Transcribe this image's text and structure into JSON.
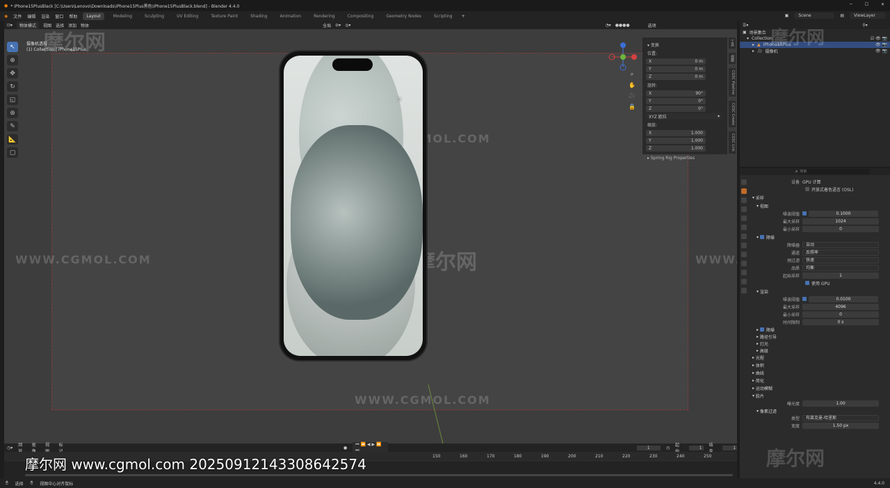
{
  "window": {
    "title": "* iPhone15PlusBlack [C:\\Users\\Lenovo\\Downloads\\iPhone15Plus黑色\\iPhone15PlusBlack.blend] - Blender 4.4.0"
  },
  "menu": [
    "文件",
    "编辑",
    "渲染",
    "窗口",
    "帮助"
  ],
  "workspaces": [
    "Layout",
    "Modeling",
    "Sculpting",
    "UV Editing",
    "Texture Paint",
    "Shading",
    "Animation",
    "Rendering",
    "Compositing",
    "Geometry Nodes",
    "Scripting"
  ],
  "active_workspace": "Layout",
  "top_right": {
    "scene": "Scene",
    "view_layer": "ViewLayer"
  },
  "viewport_header": {
    "mode": "物体模式",
    "items": [
      "视图",
      "选择",
      "添加",
      "物体"
    ],
    "transform": "全局",
    "overlay_label": "选项"
  },
  "viewport_info": {
    "view": "摄像机透视",
    "collection": "(1) Collection | iPhone15Plus"
  },
  "npanel": {
    "section": "变换",
    "location_label": "位置:",
    "location": [
      {
        "axis": "X",
        "val": "0 m"
      },
      {
        "axis": "Y",
        "val": "0 m"
      },
      {
        "axis": "Z",
        "val": "0 m"
      }
    ],
    "rotation_label": "旋转:",
    "rotation": [
      {
        "axis": "X",
        "val": "90°"
      },
      {
        "axis": "Y",
        "val": "0°"
      },
      {
        "axis": "Z",
        "val": "0°"
      }
    ],
    "rotation_mode": "XYZ 欧拉",
    "scale_label": "缩放:",
    "scale": [
      {
        "axis": "X",
        "val": "1.000"
      },
      {
        "axis": "Y",
        "val": "1.000"
      },
      {
        "axis": "Z",
        "val": "1.000"
      }
    ],
    "spring": "Spring Rig Properties"
  },
  "side_tabs": [
    "工具",
    "视图",
    "CGSC Pipeline",
    "CGSC Create",
    "CGSC Link"
  ],
  "outliner": {
    "scene_collection": "场景集合",
    "items": [
      {
        "name": "Collection",
        "depth": 1,
        "selected": false
      },
      {
        "name": "iPhone15Plus",
        "depth": 2,
        "selected": true
      },
      {
        "name": "摄像机",
        "depth": 2,
        "selected": false
      }
    ]
  },
  "properties": {
    "search_placeholder": "搜索",
    "device_label": "设备",
    "device": "GPU 计算",
    "osl": "开放式着色语言 (OSL)",
    "sampling": "采样",
    "viewport": "视图",
    "vp_noise_label": "噪波阈值",
    "vp_noise": "0.1000",
    "vp_max_label": "最大采样",
    "vp_max": "1024",
    "vp_min_label": "最小采样",
    "vp_min": "0",
    "denoise": "降噪",
    "denoiser_label": "降噪器",
    "denoiser": "自动",
    "passes_label": "通道",
    "passes": "反照率",
    "prefilter_label": "预过滤",
    "prefilter": "快速",
    "quality_label": "品质",
    "quality": "均衡",
    "start_sample_label": "起始采样",
    "start_sample": "1",
    "use_gpu": "使用 GPU",
    "render": "渲染",
    "r_noise_label": "噪波阈值",
    "r_noise": "0.0100",
    "r_max_label": "最大采样",
    "r_max": "4096",
    "r_min_label": "最小采样",
    "r_min": "0",
    "r_time_label": "时间限制",
    "r_time": "0 s",
    "sub_sections": [
      "降噪",
      "路径引导",
      "灯光",
      "高级"
    ],
    "sections": [
      "光程",
      "体积",
      "曲线",
      "简化",
      "运动模糊",
      "胶片"
    ],
    "exposure_label": "曝光度",
    "exposure": "1.00",
    "pixel_filter": "像素过滤",
    "type_label": "类型",
    "type": "布莱克曼-哈里斯",
    "width_label": "宽度",
    "width": "1.50 px"
  },
  "timeline": {
    "menus": [
      "回放",
      "抠像",
      "视图",
      "标记"
    ],
    "current_frame": "1",
    "start_label": "起始",
    "start": "1",
    "end_label": "结束",
    "end": "1",
    "ticks": [
      "150",
      "160",
      "170",
      "180",
      "190",
      "200",
      "210",
      "220",
      "230",
      "240",
      "250"
    ]
  },
  "statusbar": {
    "left": "选择",
    "mid": "视图中心对齐鼠标",
    "version": "4.4.0"
  },
  "watermarks": {
    "site": "WWW.CGMOL.COM",
    "cn": "摩尔网",
    "banner": "摩尔网 www.cgmol.com 20250912143308642574"
  }
}
